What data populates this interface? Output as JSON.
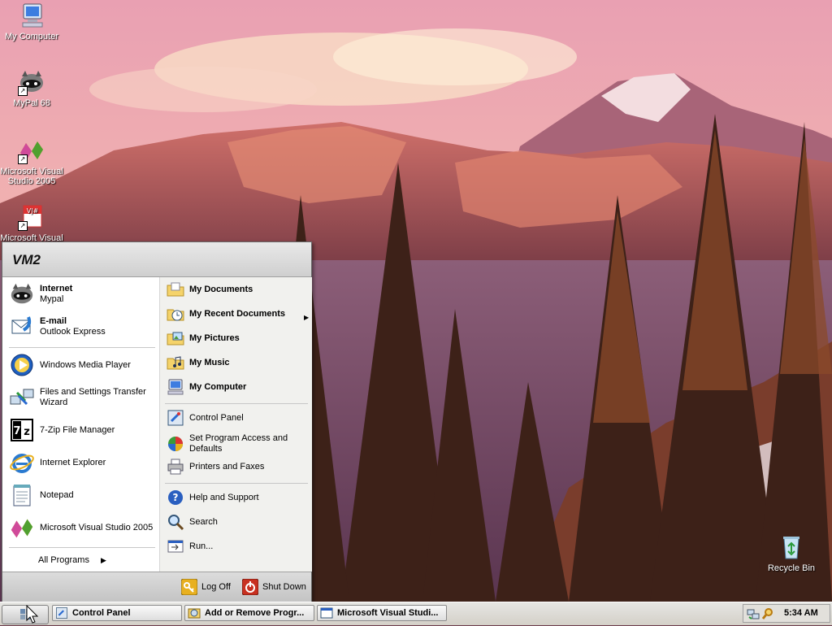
{
  "desktop": {
    "icons": [
      {
        "label": "My Computer",
        "icon": "my-computer-icon"
      },
      {
        "label": "MyPal 68",
        "icon": "mypal-raccoon-icon"
      },
      {
        "label": "Microsoft Visual Studio 2005",
        "icon": "visual-studio-icon"
      },
      {
        "label": "Microsoft Visual",
        "icon": "visual-jsharp-icon"
      },
      {
        "label": "Recycle Bin",
        "icon": "recycle-bin-icon"
      }
    ]
  },
  "start_menu": {
    "user": "VM2",
    "pinned": [
      {
        "title": "Internet",
        "subtitle": "Mypal",
        "icon": "mypal-raccoon-icon"
      },
      {
        "title": "E-mail",
        "subtitle": "Outlook Express",
        "icon": "outlook-express-icon"
      }
    ],
    "recent": [
      {
        "label": "Windows Media Player",
        "icon": "windows-media-player-icon"
      },
      {
        "label": "Files and Settings Transfer Wizard",
        "icon": "transfer-wizard-icon"
      },
      {
        "label": "7-Zip File Manager",
        "icon": "7zip-icon"
      },
      {
        "label": "Internet Explorer",
        "icon": "internet-explorer-icon"
      },
      {
        "label": "Notepad",
        "icon": "notepad-icon"
      },
      {
        "label": "Microsoft Visual Studio 2005",
        "icon": "visual-studio-icon"
      }
    ],
    "all_programs": "All Programs",
    "places": [
      {
        "label": "My Documents",
        "icon": "folder-documents-icon"
      },
      {
        "label": "My Recent Documents",
        "icon": "recent-documents-icon"
      },
      {
        "label": "My Pictures",
        "icon": "folder-pictures-icon"
      },
      {
        "label": "My Music",
        "icon": "folder-music-icon"
      },
      {
        "label": "My Computer",
        "icon": "my-computer-icon"
      }
    ],
    "settings": [
      {
        "label": "Control Panel",
        "icon": "control-panel-icon"
      },
      {
        "label": "Set Program Access and Defaults",
        "icon": "program-access-icon"
      },
      {
        "label": "Printers and Faxes",
        "icon": "printer-icon"
      }
    ],
    "tools": [
      {
        "label": "Help and Support",
        "icon": "help-icon"
      },
      {
        "label": "Search",
        "icon": "search-icon"
      },
      {
        "label": "Run...",
        "icon": "run-icon"
      }
    ],
    "log_off": "Log Off",
    "shut_down": "Shut Down"
  },
  "taskbar": {
    "tasks": [
      {
        "label": "Control Panel",
        "icon": "control-panel-icon"
      },
      {
        "label": "Add or Remove Progr...",
        "icon": "add-remove-programs-icon"
      },
      {
        "label": "Microsoft Visual Studi...",
        "icon": "visual-studio-icon"
      }
    ],
    "clock": "5:34 AM"
  }
}
